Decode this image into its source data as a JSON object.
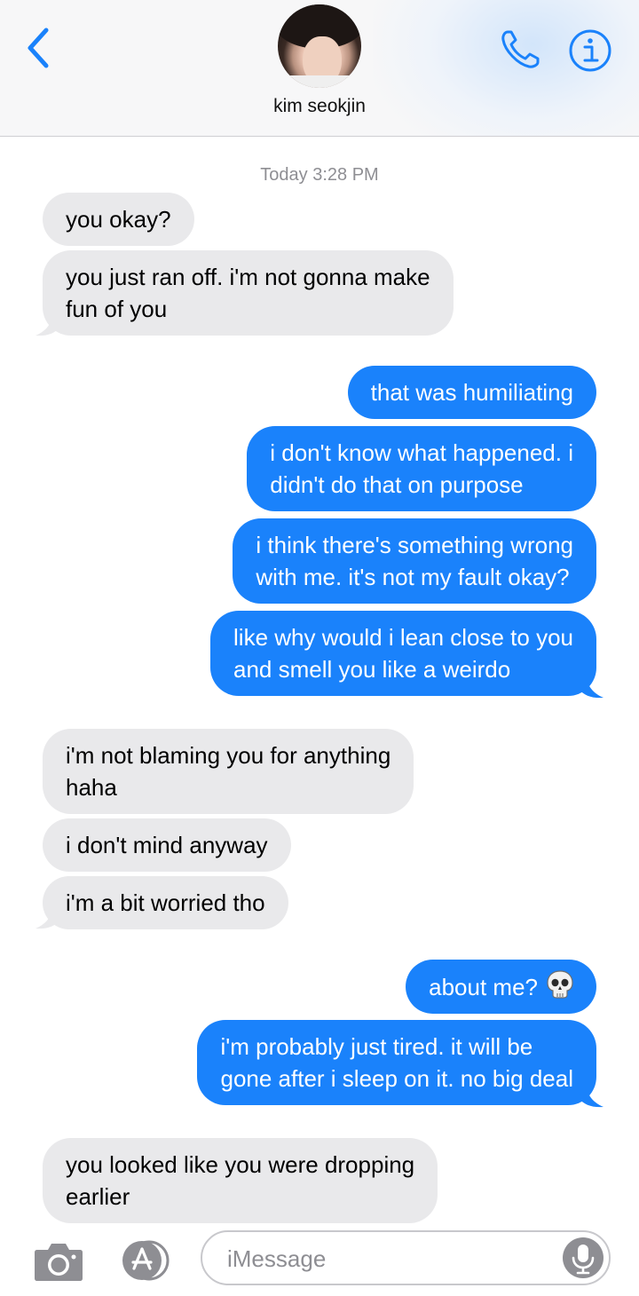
{
  "header": {
    "contact_name": "kim seokjin"
  },
  "thread": {
    "timestamp": "Today 3:28 PM",
    "messages": [
      {
        "dir": "in",
        "lines": [
          "you okay?"
        ]
      },
      {
        "dir": "in",
        "lines": [
          "you just ran off. i'm not gonna make",
          "fun of you"
        ]
      },
      {
        "dir": "out",
        "lines": [
          "that was humiliating"
        ]
      },
      {
        "dir": "out",
        "lines": [
          "i don't know what happened. i",
          "didn't do that on purpose"
        ]
      },
      {
        "dir": "out",
        "lines": [
          "i think there's something wrong",
          "with me. it's not my fault okay?"
        ]
      },
      {
        "dir": "out",
        "lines": [
          "like why would i lean close to you",
          "and smell you like a weirdo"
        ]
      },
      {
        "dir": "in",
        "lines": [
          "i'm not blaming you for anything",
          "haha"
        ]
      },
      {
        "dir": "in",
        "lines": [
          "i don't mind anyway"
        ]
      },
      {
        "dir": "in",
        "lines": [
          "i'm a bit worried tho"
        ]
      },
      {
        "dir": "out",
        "lines": [
          "about me?"
        ],
        "emoji": "skull-icon"
      },
      {
        "dir": "out",
        "lines": [
          "i'm probably just tired. it will be",
          "gone after i sleep on it. no big deal"
        ]
      },
      {
        "dir": "in",
        "lines": [
          "you looked like you were dropping",
          "earlier"
        ]
      }
    ]
  },
  "input": {
    "placeholder": "iMessage"
  },
  "icons": {
    "back": "chevron-left-icon",
    "call": "phone-icon",
    "info": "info-icon",
    "camera": "camera-icon",
    "apps": "app-store-icon",
    "mic": "microphone-icon"
  },
  "colors": {
    "accent": "#1a82fb",
    "incoming_bubble": "#e9e9eb",
    "outgoing_bubble": "#1a82fb",
    "secondary_text": "#8e8e93"
  }
}
